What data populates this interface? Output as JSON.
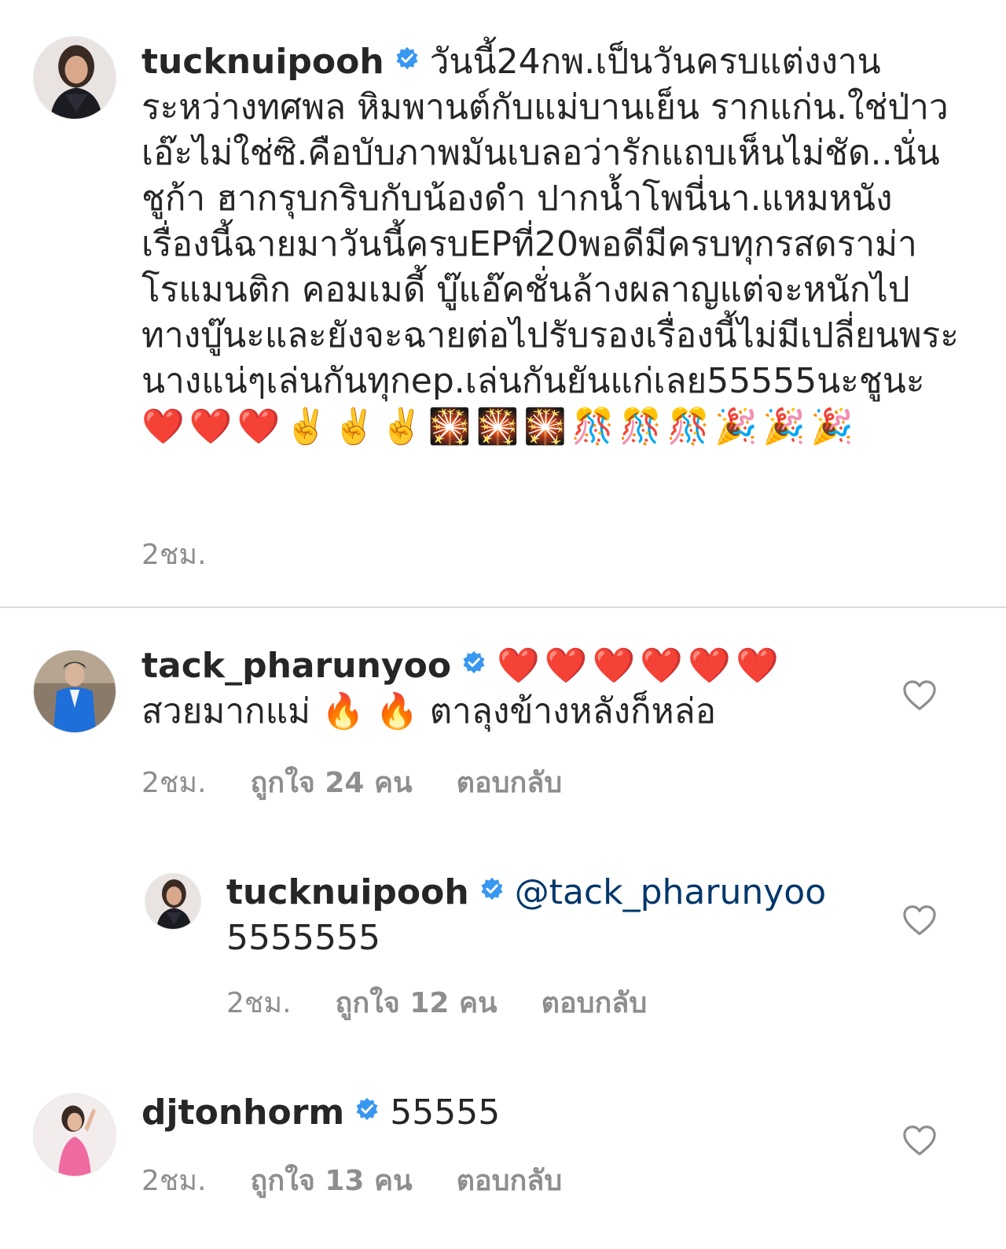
{
  "caption": {
    "username": "tucknuipooh",
    "text": "วันนี้24กพ.เป็นวันครบแต่งงานระหว่างทศพล หิมพานต์กับแม่บานเย็น รากแก่น.ใช่ป่าวเอ๊ะไม่ใช่ซิ.คือบับภาพมันเบลอว่ารักแถบเห็นไม่ชัด..นั่นชูก้า ฮากรุบกริบกับน้องดำ ปากน้ำโพนี่นา.แหมหนังเรื่องนี้ฉายมาวันนี้ครบEPที่20พอดีมีครบทุกรสดราม่า โรแมนติก คอมเมดี้ บู๊แอ๊คชั่นล้างผลาญแต่จะหนักไปทางบู๊นะและยังจะฉายต่อไปรับรองเรื่องนี้ไม่มีเปลี่ยนพระนางแน่ๆเล่นกันทุกep.เล่นกันยันแก่เลย55555นะชูนะ",
    "emojis": "❤️❤️❤️✌️✌️✌️🎇🎇🎇🎊🎊🎊🎉🎉🎉",
    "time": "2ชม."
  },
  "comments": [
    {
      "username": "tack_pharunyoo",
      "emojis": "❤️❤️❤️❤️❤️❤️",
      "text": "สวยมากแม่ 🔥 🔥  ตาลุงข้างหลังก็หล่อ",
      "time": "2ชม.",
      "likes": "ถูกใจ 24 คน",
      "reply": "ตอบกลับ"
    },
    {
      "username": "tucknuipooh",
      "mention": "@tack_pharunyoo",
      "text": "5555555",
      "time": "2ชม.",
      "likes": "ถูกใจ 12 คน",
      "reply": "ตอบกลับ"
    },
    {
      "username": "djtonhorm",
      "text": "55555",
      "time": "2ชม.",
      "likes": "ถูกใจ 13 คน",
      "reply": "ตอบกลับ"
    }
  ],
  "icons": {
    "verified": "verified-badge-icon",
    "like": "heart-outline-icon"
  },
  "colors": {
    "verified": "#3897f0",
    "mention": "#00376b",
    "meta": "#8e8e8e"
  }
}
